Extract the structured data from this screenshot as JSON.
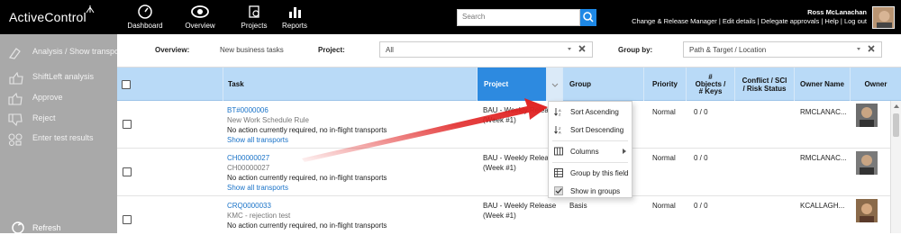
{
  "app": {
    "logo_text": "ActiveControl"
  },
  "nav": [
    {
      "label": "Dashboard",
      "icon": "gauge-icon"
    },
    {
      "label": "Overview",
      "icon": "eye-icon"
    },
    {
      "label": "Projects",
      "icon": "projects-icon"
    },
    {
      "label": "Reports",
      "icon": "bar-chart-icon"
    }
  ],
  "search": {
    "placeholder": "Search"
  },
  "user": {
    "name": "Ross McLanachan",
    "links": "Change & Release Manager | Edit details | Delegate approvals | Help | Log out"
  },
  "sidebar": {
    "items": [
      {
        "label": "Analysis / Show transports",
        "icon": "analysis-icon"
      },
      {
        "label": "ShiftLeft analysis",
        "icon": "thumbs-up-icon"
      },
      {
        "label": "Approve",
        "icon": "approve-icon"
      },
      {
        "label": "Reject",
        "icon": "reject-icon"
      },
      {
        "label": "Enter test results",
        "icon": "test-results-icon"
      }
    ],
    "refresh": "Refresh"
  },
  "filters": {
    "overview_label": "Overview:",
    "overview_value": "New business tasks",
    "project_label": "Project:",
    "project_value": "All",
    "groupby_label": "Group by:",
    "groupby_value": "Path & Target / Location"
  },
  "columns": {
    "task": "Task",
    "project": "Project",
    "group": "Group",
    "priority": "Priority",
    "objects_line1": "#",
    "objects_line2": "Objects /",
    "objects_line3": "# Keys",
    "conflict_line1": "Conflict / SCI",
    "conflict_line2": "/ Risk Status",
    "owner_name": "Owner Name",
    "owner": "Owner"
  },
  "rows": [
    {
      "id": "BT#0000006",
      "title": "New Work Schedule Rule",
      "status": "No action currently required, no in-flight transports",
      "link": "Show all transports",
      "project_line1": "BAU - Weekly Relea",
      "project_line2": "(Week #1)",
      "group": "",
      "priority": "Normal",
      "objects": "0 / 0",
      "owner_name": "RMCLANAC..."
    },
    {
      "id": "CH00000027",
      "title": "CH00000027",
      "status": "No action currently required, no in-flight transports",
      "link": "Show all transports",
      "project_line1": "BAU - Weekly Release",
      "project_line2": "(Week #1)",
      "group": "",
      "priority": "Normal",
      "objects": "0 / 0",
      "owner_name": "RMCLANAC..."
    },
    {
      "id": "CRQ0000033",
      "title": "KMC - rejection test",
      "status": "No action currently required, no in-flight transports",
      "link": "",
      "project_line1": "BAU - Weekly Release",
      "project_line2": "(Week #1)",
      "group": "Basis",
      "priority": "Normal",
      "objects": "0 / 0",
      "owner_name": "KCALLAGH..."
    }
  ],
  "context_menu": {
    "items": [
      {
        "label": "Sort Ascending",
        "icon": "sort-ascending-icon"
      },
      {
        "label": "Sort Descending",
        "icon": "sort-descending-icon"
      },
      {
        "label": "Columns",
        "icon": "columns-icon"
      },
      {
        "label": "Group by this field",
        "icon": "group-by-icon"
      },
      {
        "label": "Show in groups",
        "icon": "show-in-groups-icon"
      }
    ]
  },
  "colors": {
    "topbar": "#000000",
    "sidebar": "#a9a9a9",
    "header": "#b9daf7",
    "project_header": "#2d8ae0",
    "link": "#1a73c8",
    "arrow": "#e02020"
  }
}
